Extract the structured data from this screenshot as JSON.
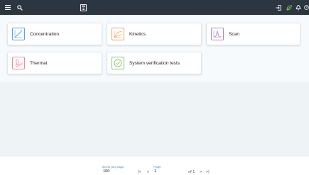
{
  "topbar": {
    "menu_icon": "hamburger-menu-icon",
    "search_icon": "search-icon",
    "center_icon": "calculator-icon",
    "right_icons": [
      "sign-in-icon",
      "leaf-icon",
      "bell-icon",
      "help-icon"
    ]
  },
  "tiles": [
    {
      "label": "Concentration",
      "icon": "concentration-icon",
      "color": "#5aa3dc"
    },
    {
      "label": "Kinetics",
      "icon": "kinetics-icon",
      "color": "#f0a25a"
    },
    {
      "label": "Scan",
      "icon": "scan-icon",
      "color": "#b58ac6"
    },
    {
      "label": "Thermal",
      "icon": "thermal-icon",
      "color": "#ee8a9a"
    },
    {
      "label": "System verification tests",
      "icon": "check-circle-icon",
      "color": "#8cc26a"
    }
  ],
  "pagination": {
    "items_per_page_label": "Items per page",
    "items_per_page_value": "100",
    "page_label": "Page",
    "page_value": "1",
    "of_text": "of 1",
    "first_glyph": "|<",
    "prev_glyph": "<",
    "next_glyph": ">",
    "last_glyph": ">|"
  },
  "colors": {
    "topbar_bg": "#2c3641",
    "content_bg": "#eef3f6",
    "tile_area_bg": "#f6fafc",
    "accent_link": "#5a8fc6",
    "leaf_green": "#7dc243"
  }
}
